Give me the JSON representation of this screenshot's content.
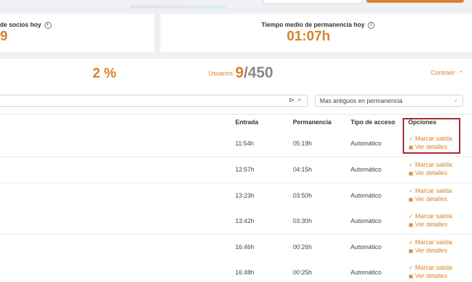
{
  "stats": {
    "socios_label": "de socios hoy",
    "socios_value": "9",
    "tiempo_label": "Tiempo medio de permanencia hoy",
    "tiempo_value": "01:07h"
  },
  "summary": {
    "percent": "2 %",
    "usuarios_label": "Usuarios",
    "usuarios_current": "9",
    "usuarios_total": "/450",
    "contraer_label": "Contraer"
  },
  "filters": {
    "search_placeholder": "",
    "sort_selected": "Mas antiguos en permanencia"
  },
  "table": {
    "headers": [
      "Entrada",
      "Permanencia",
      "Tipo de acceso",
      "Opciones"
    ],
    "marcar_label": "Marcar salida",
    "detalles_label": "Ver detalles",
    "rows": [
      {
        "entrada": "11:54h",
        "permanencia": "05:19h",
        "tipo": "Automático"
      },
      {
        "entrada": "12:57h",
        "permanencia": "04:15h",
        "tipo": "Automático"
      },
      {
        "entrada": "13:23h",
        "permanencia": "03:50h",
        "tipo": "Automático"
      },
      {
        "entrada": "13:42h",
        "permanencia": "03:30h",
        "tipo": "Automático"
      },
      {
        "entrada": "16:46h",
        "permanencia": "00:26h",
        "tipo": "Automático"
      },
      {
        "entrada": "16:48h",
        "permanencia": "00:25h",
        "tipo": "Automático"
      }
    ]
  },
  "icons": {
    "info": "info-icon",
    "chevron_up": "chevron-up-icon",
    "chevron_down": "chevron-down-icon",
    "search": "search-icon",
    "scan": "scan-icon",
    "check_circle": "check-circle-icon",
    "lock": "lock-icon"
  },
  "colors": {
    "accent": "#d9822b",
    "highlight_border": "#a3202a"
  }
}
